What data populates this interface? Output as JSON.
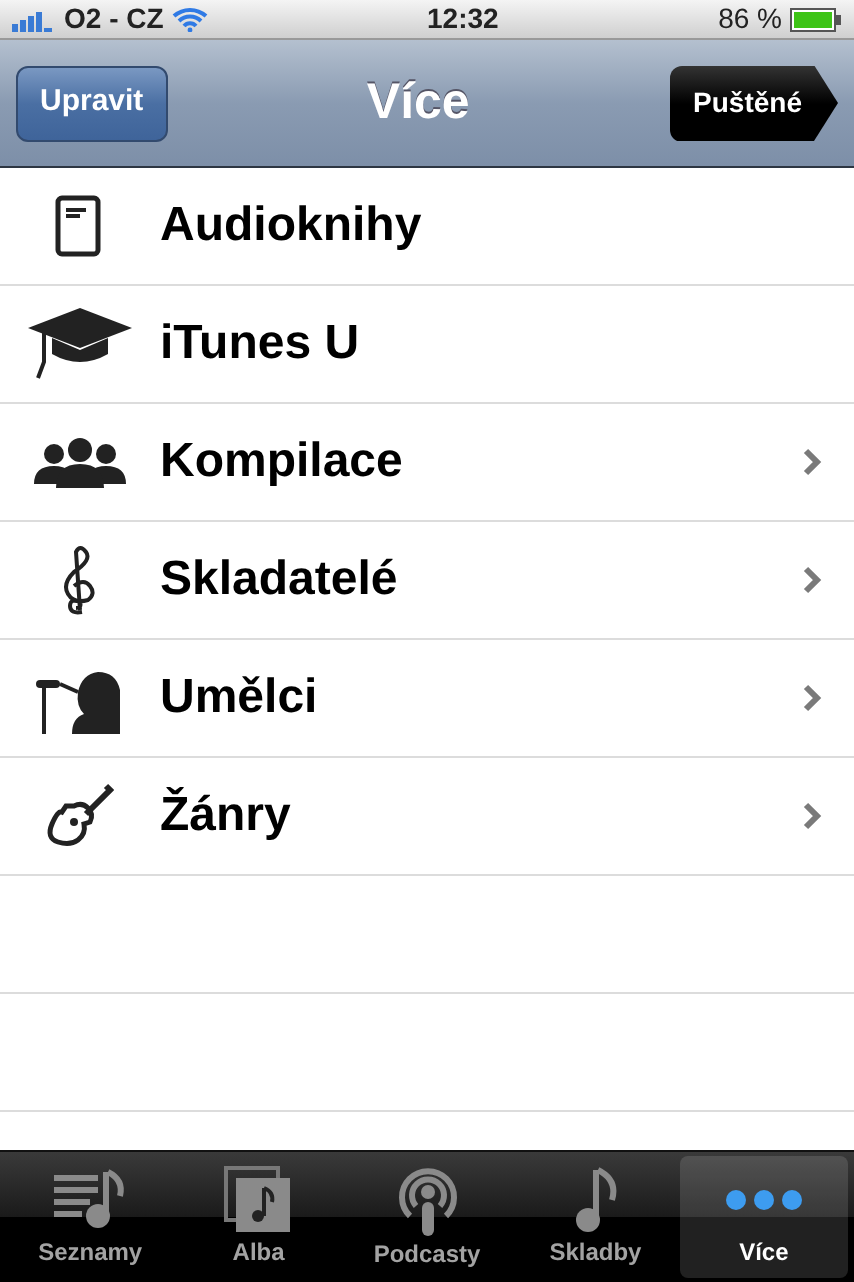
{
  "status_bar": {
    "carrier": "O2 - CZ",
    "time": "12:32",
    "battery": "86 %"
  },
  "nav_bar": {
    "left_button": "Upravit",
    "title": "Více",
    "right_button": "Puštěné"
  },
  "items": [
    {
      "label": "Audioknihy",
      "chevron": false
    },
    {
      "label": "iTunes U",
      "chevron": false
    },
    {
      "label": "Kompilace",
      "chevron": true
    },
    {
      "label": "Skladatelé",
      "chevron": true
    },
    {
      "label": "Umělci",
      "chevron": true
    },
    {
      "label": "Žánry",
      "chevron": true
    }
  ],
  "tab_bar": [
    {
      "label": "Seznamy",
      "selected": false
    },
    {
      "label": "Alba",
      "selected": false
    },
    {
      "label": "Podcasty",
      "selected": false
    },
    {
      "label": "Skladby",
      "selected": false
    },
    {
      "label": "Více",
      "selected": true
    }
  ]
}
